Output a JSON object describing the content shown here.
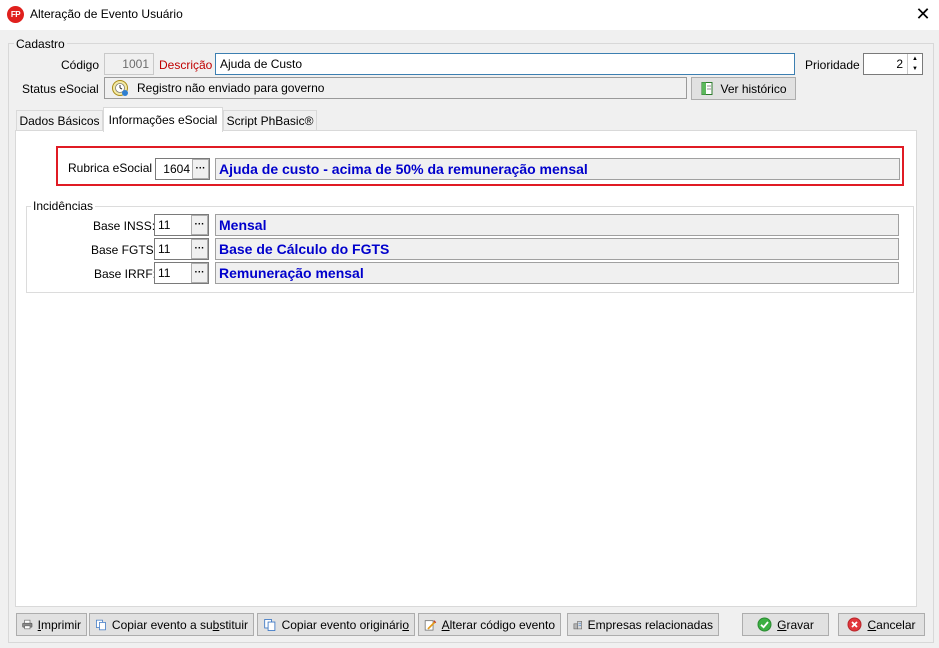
{
  "window": {
    "title": "Alteração de Evento Usuário",
    "icon_text": "FP"
  },
  "cadastro": {
    "group_label": "Cadastro",
    "codigo_label": "Código",
    "codigo_value": "1001",
    "descricao_label": "Descrição",
    "descricao_value": "Ajuda de Custo",
    "prioridade_label": "Prioridade",
    "prioridade_value": "2",
    "status_label": "Status eSocial",
    "status_text": "Registro não enviado para governo",
    "historico_button": "Ver histórico"
  },
  "tabs": [
    {
      "label": "Dados Básicos"
    },
    {
      "label": "Informações eSocial"
    },
    {
      "label": "Script PhBasic®"
    }
  ],
  "esocial": {
    "rubrica_label": "Rubrica eSocial",
    "rubrica_code": "1604",
    "rubrica_desc": "Ajuda de custo - acima de 50% da remuneração mensal"
  },
  "incidencias": {
    "group_label": "Incidências",
    "rows": [
      {
        "label": "Base INSS:",
        "code": "11",
        "desc": "Mensal"
      },
      {
        "label": "Base FGTS:",
        "code": "11",
        "desc": "Base de Cálculo do FGTS"
      },
      {
        "label": "Base IRRF:",
        "code": "11",
        "desc": "Remuneração mensal"
      }
    ]
  },
  "footer": {
    "imprimir": {
      "pre": "",
      "u": "I",
      "post": "mprimir"
    },
    "copiar_substituir": {
      "pre": "Copiar evento a su",
      "u": "b",
      "post": "stituir"
    },
    "copiar_original": {
      "pre": "Copiar evento originári",
      "u": "o",
      "post": ""
    },
    "alterar_codigo": {
      "pre": "",
      "u": "A",
      "post": "lterar código evento"
    },
    "empresas": {
      "pre": "Empresas relacionadas",
      "u": "",
      "post": ""
    },
    "gravar": {
      "pre": "",
      "u": "G",
      "post": "ravar"
    },
    "cancelar": {
      "pre": "",
      "u": "C",
      "post": "ancelar"
    }
  },
  "colors": {
    "accent_red": "#e01b24",
    "link_blue": "#0000cc",
    "required_red": "#c00000"
  }
}
